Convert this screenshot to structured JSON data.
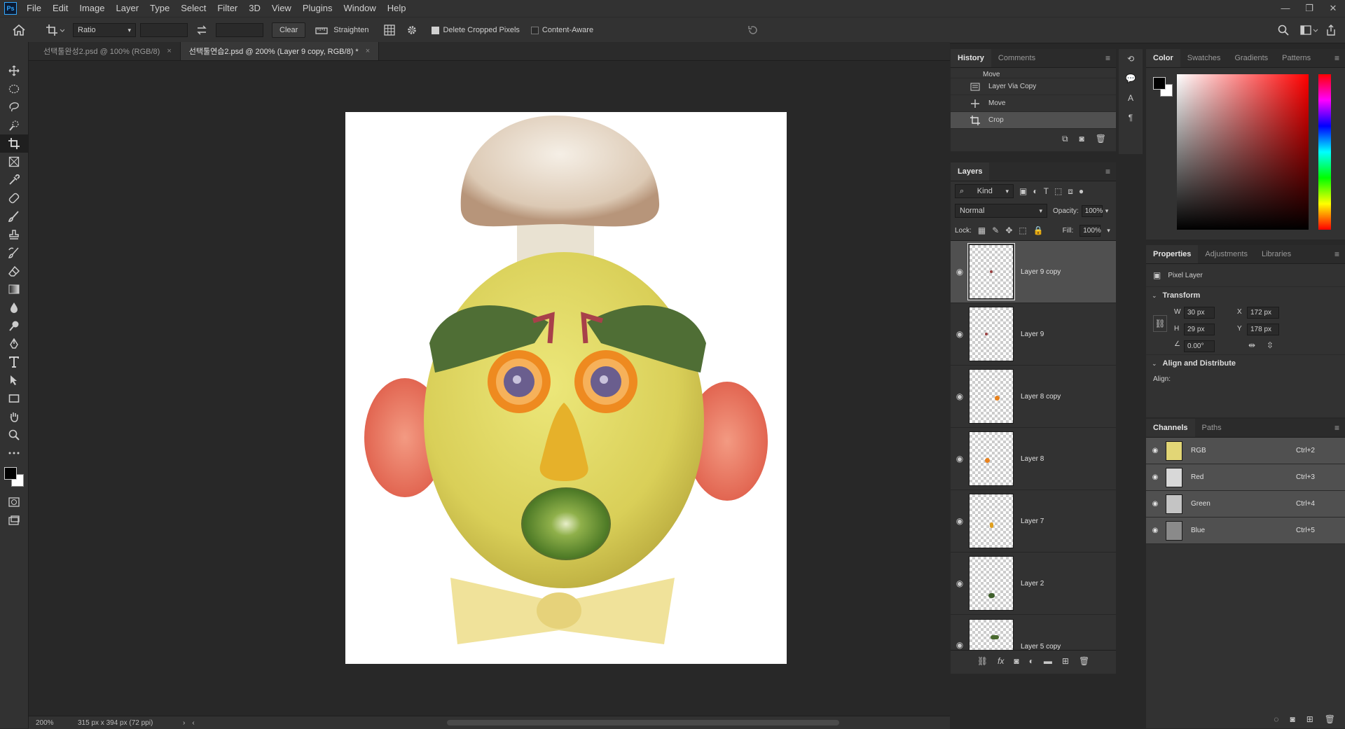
{
  "app": {
    "logo_text": "Ps"
  },
  "menu": [
    "File",
    "Edit",
    "Image",
    "Layer",
    "Type",
    "Select",
    "Filter",
    "3D",
    "View",
    "Plugins",
    "Window",
    "Help"
  ],
  "options": {
    "ratio_label": "Ratio",
    "clear_label": "Clear",
    "straighten_label": "Straighten",
    "delete_cropped_label": "Delete Cropped Pixels",
    "delete_cropped_checked": true,
    "content_aware_label": "Content-Aware",
    "content_aware_checked": false
  },
  "tabs": [
    {
      "label": "선택툴완성2.psd @ 100% (RGB/8)",
      "active": false
    },
    {
      "label": "선택툴연습2.psd @ 200% (Layer 9 copy, RGB/8) *",
      "active": true
    }
  ],
  "status": {
    "zoom": "200%",
    "doc_info": "315 px x 394 px (72 ppi)"
  },
  "history": {
    "tabs": [
      "History",
      "Comments"
    ],
    "items": [
      {
        "label": "Move",
        "icon": "move-icon",
        "selected": false
      },
      {
        "label": "Layer Via Copy",
        "icon": "layer-icon",
        "selected": false
      },
      {
        "label": "Move",
        "icon": "move-icon",
        "selected": false
      },
      {
        "label": "Crop",
        "icon": "crop-icon",
        "selected": true
      }
    ]
  },
  "layers": {
    "title": "Layers",
    "filter_kind": "Kind",
    "blend_mode": "Normal",
    "opacity_label": "Opacity:",
    "opacity": "100%",
    "lock_label": "Lock:",
    "fill_label": "Fill:",
    "fill": "100%",
    "items": [
      {
        "name": "Layer 9 copy",
        "selected": true,
        "dot": "#9a4040"
      },
      {
        "name": "Layer 9",
        "selected": false,
        "dot": "#9a4040"
      },
      {
        "name": "Layer 8 copy",
        "selected": false,
        "dot": "#e8821e"
      },
      {
        "name": "Layer 8",
        "selected": false,
        "dot": "#e8821e"
      },
      {
        "name": "Layer 7",
        "selected": false,
        "dot": "#e0a020"
      },
      {
        "name": "Layer 2",
        "selected": false,
        "dot": "#3f5f2c"
      },
      {
        "name": "Layer 5 copy",
        "selected": false,
        "dot": "#4a6a30"
      }
    ]
  },
  "color_panel": {
    "tabs": [
      "Color",
      "Swatches",
      "Gradients",
      "Patterns"
    ],
    "hue": "#ff0000"
  },
  "properties": {
    "tabs": [
      "Properties",
      "Adjustments",
      "Libraries"
    ],
    "type_label": "Pixel Layer",
    "transform_label": "Transform",
    "w_label": "W",
    "w": "30 px",
    "h_label": "H",
    "h": "29 px",
    "x_label": "X",
    "x": "172 px",
    "y_label": "Y",
    "y": "178 px",
    "angle": "0.00°",
    "align_section": "Align and Distribute",
    "align_label": "Align:"
  },
  "channels": {
    "tabs": [
      "Channels",
      "Paths"
    ],
    "items": [
      {
        "name": "RGB",
        "shortcut": "Ctrl+2"
      },
      {
        "name": "Red",
        "shortcut": "Ctrl+3"
      },
      {
        "name": "Green",
        "shortcut": "Ctrl+4"
      },
      {
        "name": "Blue",
        "shortcut": "Ctrl+5"
      }
    ]
  }
}
